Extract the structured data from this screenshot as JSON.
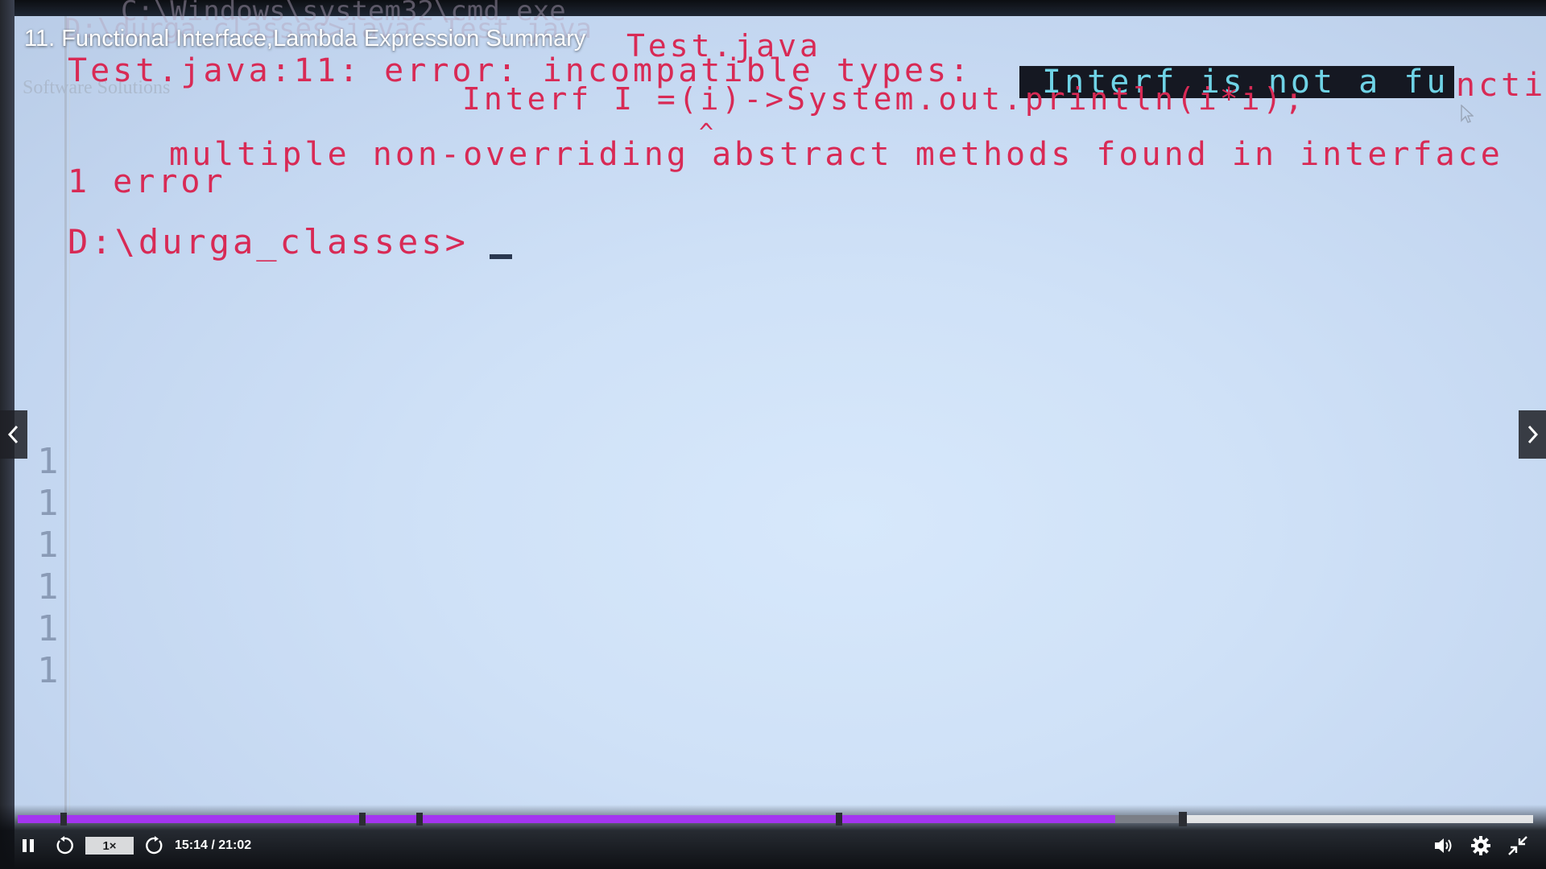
{
  "video": {
    "title": "11. Functional Interface,Lambda Expression Summary",
    "terminal": {
      "faint_header": "D:\\durga_classes>javac Test.java",
      "faint_path": "C:\\Windows\\system32\\cmd.exe",
      "watermark": "Software Solutions",
      "line1_prefix": "Test.java:11: error: incompatible types:",
      "line1_highlight": "Interf is not a fu",
      "line1_suffix": "ncti",
      "file_ref": "Test.java",
      "line2": "Interf I =(i)->System.out.println(i*i);",
      "caret": "^",
      "line3": "multiple non-overriding abstract methods found in interface",
      "line4": "1 error",
      "prompt": "D:\\durga_classes>",
      "line_numbers": [
        "1",
        "1",
        "1",
        "1",
        "1",
        "1"
      ]
    }
  },
  "controls": {
    "speed_label": "1×",
    "time": "15:14 / 21:02",
    "progress_fraction": 0.7241,
    "buffer_fraction": 0.7691,
    "chapter_fractions": [
      0.0305,
      0.2274,
      0.2651,
      0.5419
    ],
    "accent_color": "#a435f0",
    "icons": {
      "pause": "pause-icon",
      "rewind": "rewind-5-icon",
      "forward": "forward-5-icon",
      "volume": "volume-icon",
      "settings": "gear-icon",
      "exit_fullscreen": "exit-fullscreen-icon",
      "prev": "chevron-left-icon",
      "next": "chevron-right-icon"
    }
  }
}
